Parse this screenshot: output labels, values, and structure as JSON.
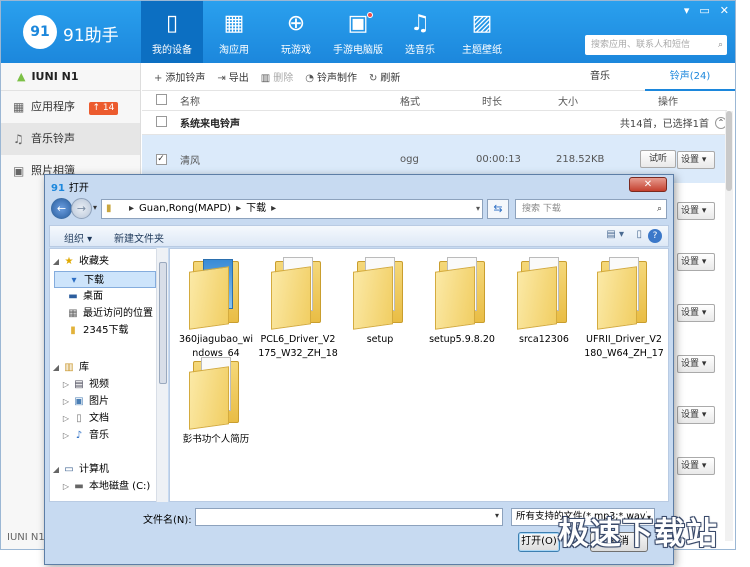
{
  "app": {
    "brand": "91助手",
    "logo_text": "91",
    "nav": [
      {
        "label": "我的设备",
        "icon": "phone-icon"
      },
      {
        "label": "淘应用",
        "icon": "apps-grid-icon"
      },
      {
        "label": "玩游戏",
        "icon": "gamepad-icon"
      },
      {
        "label": "手游电脑版",
        "icon": "monitor-game-icon"
      },
      {
        "label": "选音乐",
        "icon": "music-note-icon"
      },
      {
        "label": "主题壁纸",
        "icon": "wallpaper-icon"
      }
    ],
    "search_placeholder": "搜索应用、联系人和短信",
    "window_controls": {
      "pin": "▾",
      "minimize": "▭",
      "close": "✕"
    }
  },
  "sidebar": {
    "device": "IUNI N1",
    "items": [
      {
        "label": "应用程序",
        "badge": "14"
      },
      {
        "label": "音乐铃声"
      },
      {
        "label": "照片相簿"
      }
    ],
    "bottom_text": "IUNI N1"
  },
  "toolbar": {
    "add": "添加铃声",
    "export": "导出",
    "delete": "删除",
    "make": "铃声制作",
    "refresh": "刷新"
  },
  "tabs": {
    "music": "音乐",
    "ringtone": "铃声(24)"
  },
  "table": {
    "headers": {
      "name": "名称",
      "format": "格式",
      "duration": "时长",
      "size": "大小",
      "action": "操作"
    },
    "group": {
      "title": "系统来电铃声",
      "summary": "共14首，已选择1首"
    },
    "rows": [
      {
        "name": "清风",
        "format": "ogg",
        "duration": "00:00:13",
        "size": "218.52KB",
        "listen": "试听",
        "settings": "设置"
      }
    ],
    "settings_label": "设置"
  },
  "dialog": {
    "title": "打开",
    "breadcrumb": [
      "Guan,Rong(MAPD)",
      "下载"
    ],
    "search_placeholder": "搜索 下载",
    "organize": "组织 ▾",
    "new_folder": "新建文件夹",
    "favorites": {
      "header": "收藏夹",
      "items": [
        "下载",
        "桌面",
        "最近访问的位置",
        "2345下载"
      ]
    },
    "library": {
      "header": "库",
      "items": [
        "视频",
        "图片",
        "文档",
        "音乐"
      ]
    },
    "computer": {
      "header": "计算机",
      "items": [
        "本地磁盘 (C:)"
      ]
    },
    "folders": [
      "360jiagubao_windows_64",
      "PCL6_Driver_V2175_W32_ZH_18",
      "setup",
      "setup5.9.8.20",
      "srca12306",
      "UFRII_Driver_V2180_W64_ZH_17",
      "彭书功个人简历"
    ],
    "filename_label": "文件名(N):",
    "filename_value": "",
    "filetype": "所有支持的文件(*.mp3;*.wav)",
    "open_button": "打开(O)",
    "cancel_button": "取消"
  },
  "watermark": "极速下载站"
}
